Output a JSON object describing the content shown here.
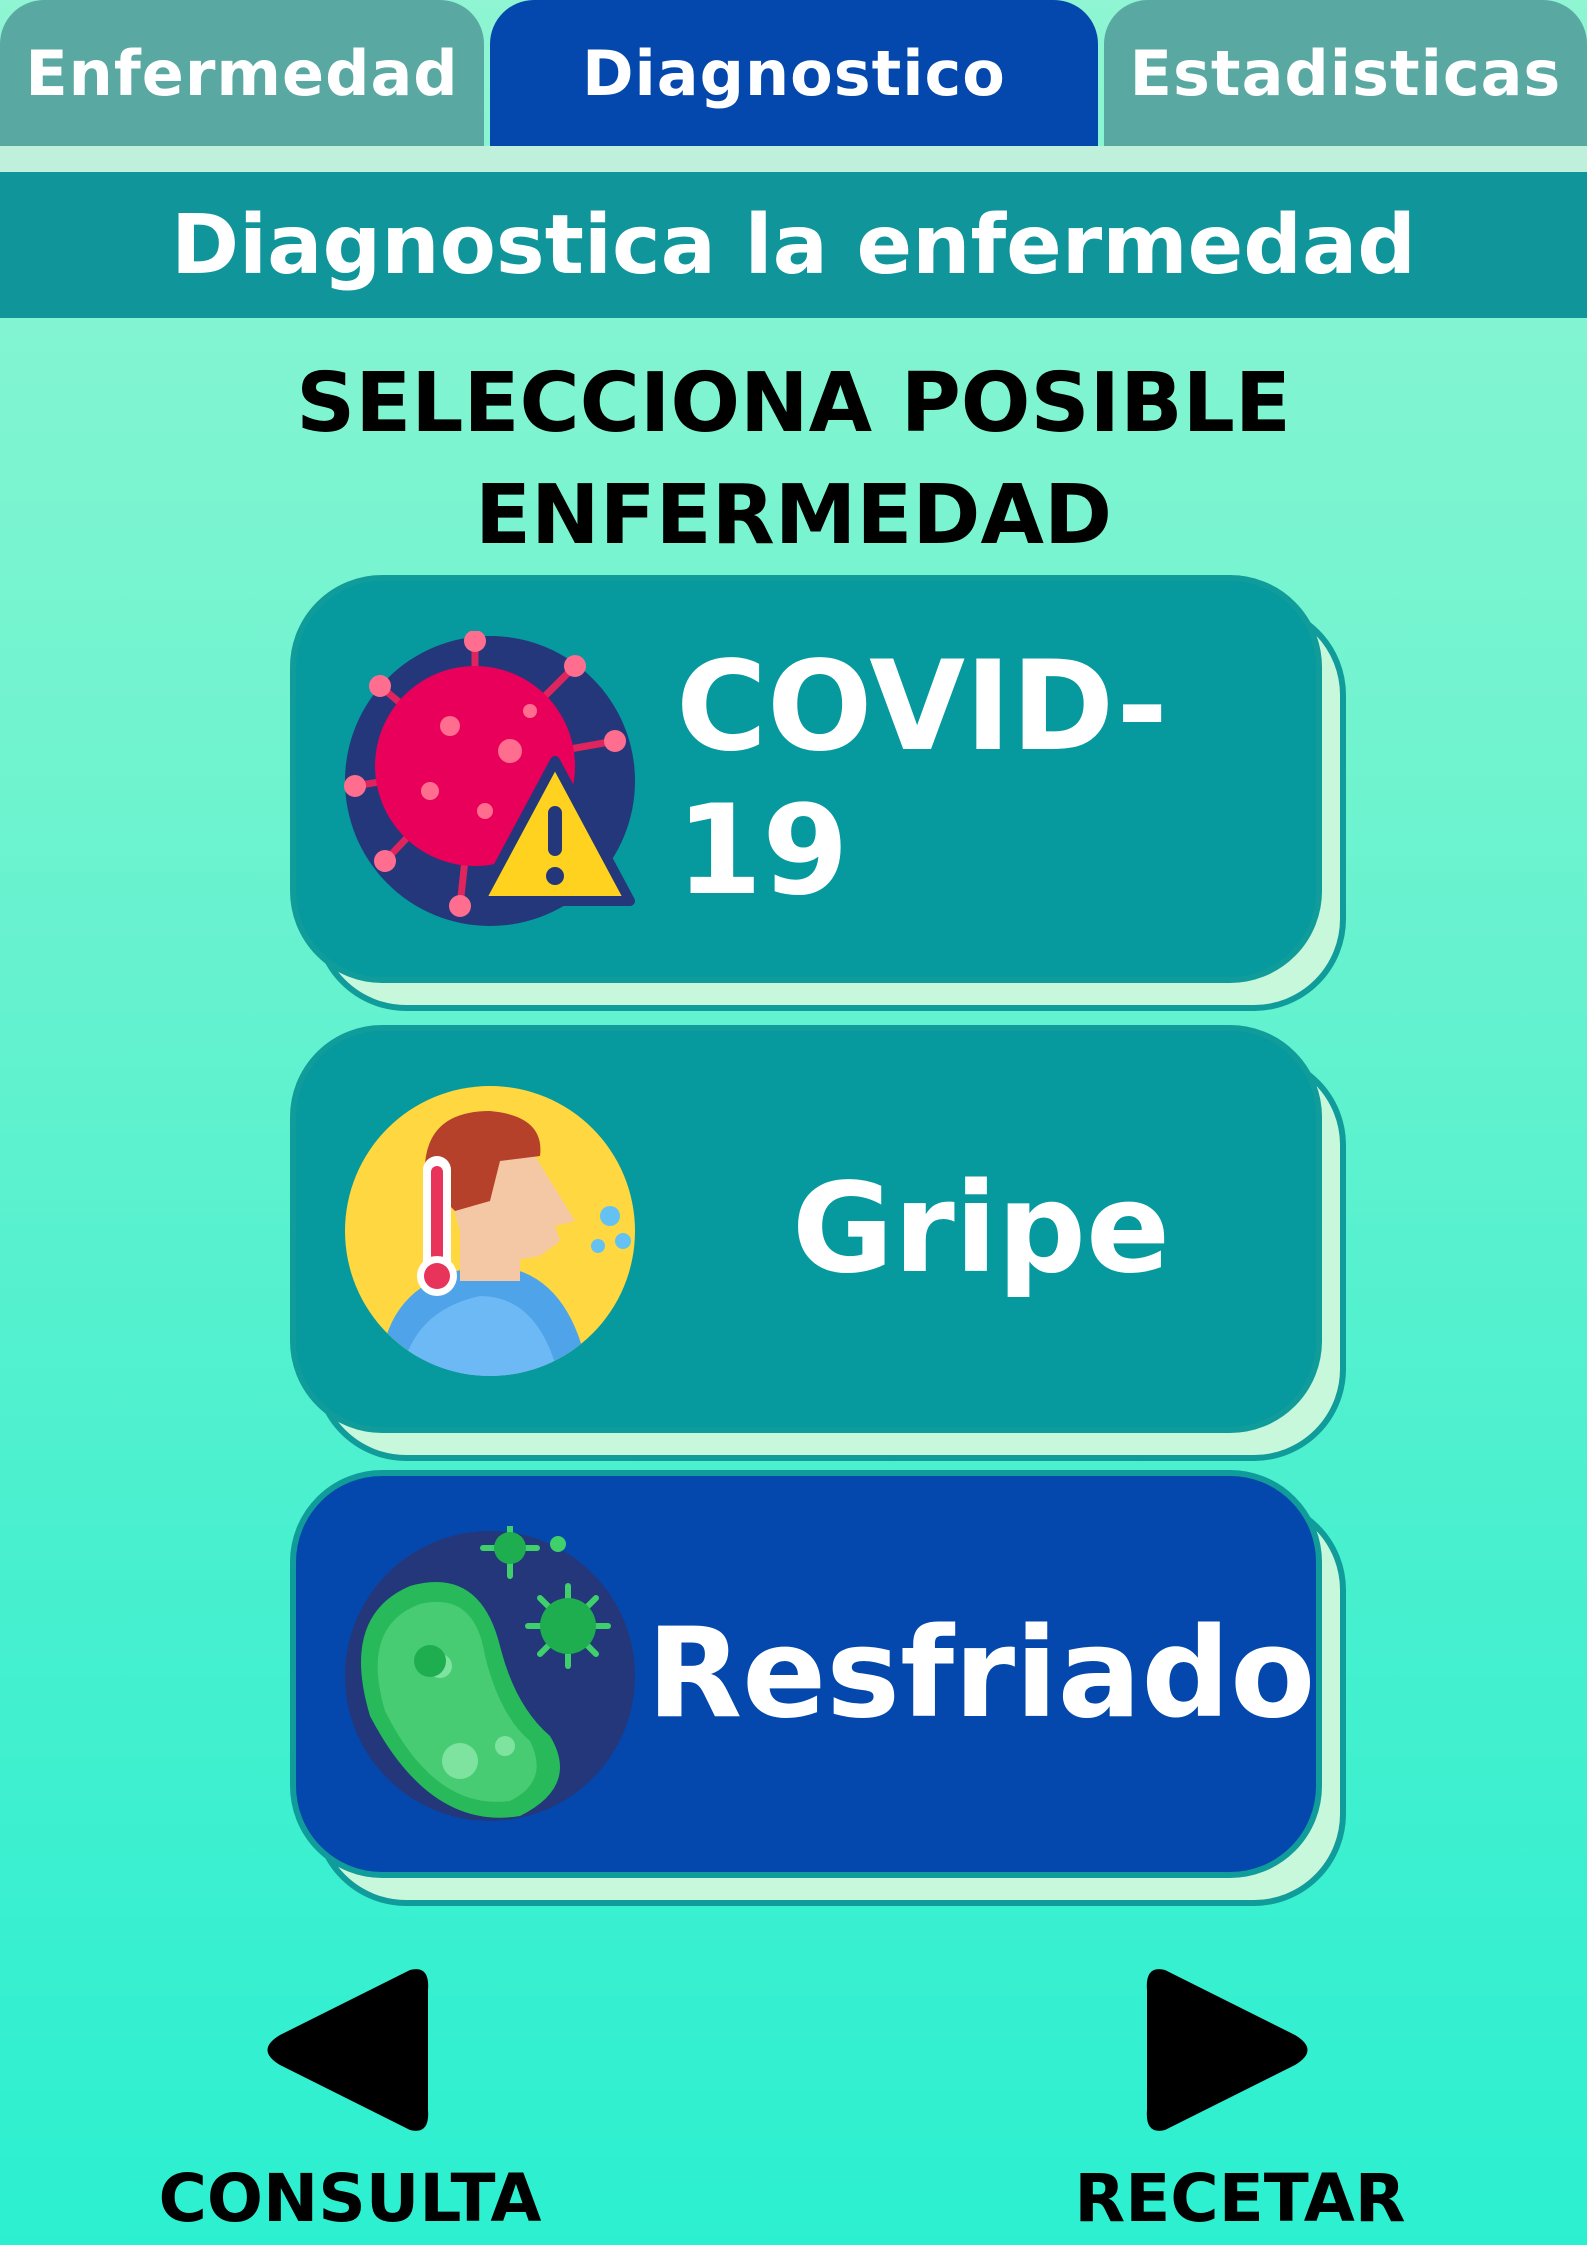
{
  "tabs": [
    {
      "label": "Enfermedad",
      "active": false
    },
    {
      "label": "Diagnostico",
      "active": true
    },
    {
      "label": "Estadisticas",
      "active": false
    }
  ],
  "header": {
    "title": "Diagnostica la enfermedad"
  },
  "instruction": {
    "line1": "SELECCIONA POSIBLE",
    "line2": "ENFERMEDAD"
  },
  "options": [
    {
      "label": "COVID-19",
      "icon": "virus-warning-icon",
      "selected": false
    },
    {
      "label": "Gripe",
      "icon": "fever-sneeze-icon",
      "selected": false
    },
    {
      "label": "Resfriado",
      "icon": "germ-bacteria-icon",
      "selected": true
    }
  ],
  "navigation": {
    "back_label": "CONSULTA",
    "next_label": "RECETAR"
  },
  "colors": {
    "active": "#0448ad",
    "inactive_tab": "#5aa8a2",
    "card": "#06999e",
    "header": "#10969a"
  }
}
